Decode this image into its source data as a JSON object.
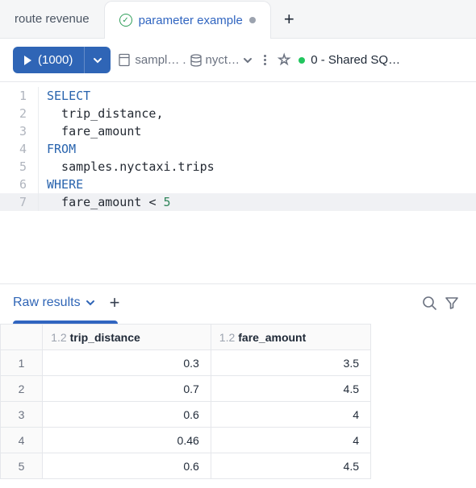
{
  "tabs": {
    "left": "route revenue",
    "active": "parameter example"
  },
  "toolbar": {
    "run_label": "(1000)",
    "catalog": "sampl…",
    "schema": "nyct…",
    "compute": "0 - Shared SQ…"
  },
  "editor": {
    "lines": {
      "1": "SELECT",
      "2": "  trip_distance,",
      "3": "  fare_amount",
      "4": "FROM",
      "5": "  samples.nyctaxi.trips",
      "6": "WHERE",
      "7a": "  fare_amount ",
      "7op": "<",
      "7b": " ",
      "7num": "5"
    }
  },
  "results": {
    "tab_label": "Raw results",
    "columns": {
      "typetag": "1.2",
      "c1": "trip_distance",
      "c2": "fare_amount"
    }
  },
  "chart_data": {
    "type": "table",
    "columns": [
      "trip_distance",
      "fare_amount"
    ],
    "rows": [
      {
        "n": 1,
        "trip_distance": 0.3,
        "fare_amount": 3.5
      },
      {
        "n": 2,
        "trip_distance": 0.7,
        "fare_amount": 4.5
      },
      {
        "n": 3,
        "trip_distance": 0.6,
        "fare_amount": 4
      },
      {
        "n": 4,
        "trip_distance": 0.46,
        "fare_amount": 4
      },
      {
        "n": 5,
        "trip_distance": 0.6,
        "fare_amount": 4.5
      }
    ]
  }
}
